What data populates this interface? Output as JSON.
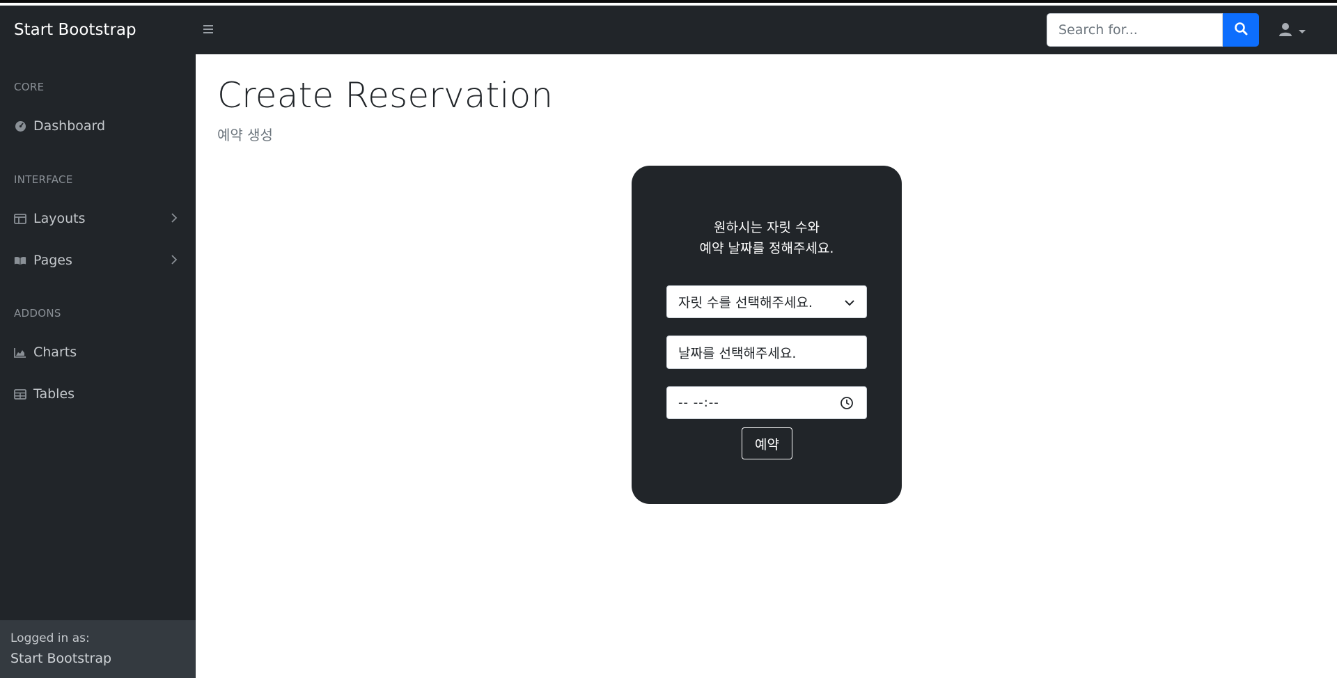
{
  "navbar": {
    "brand": "Start Bootstrap",
    "toggle_icon": "menu-icon",
    "search": {
      "placeholder": "Search for...",
      "value": ""
    },
    "search_button_icon": "search-icon",
    "user_menu_icon": "user-icon",
    "accent_color": "#0d6efd"
  },
  "sidebar": {
    "sections": [
      {
        "heading": "CORE"
      },
      {
        "heading": "INTERFACE"
      },
      {
        "heading": "ADDONS"
      }
    ],
    "items": [
      {
        "label": "Dashboard",
        "icon": "dashboard-icon"
      },
      {
        "label": "Layouts",
        "icon": "columns-icon",
        "has_submenu": true
      },
      {
        "label": "Pages",
        "icon": "book-icon",
        "has_submenu": true
      },
      {
        "label": "Charts",
        "icon": "area-chart-icon"
      },
      {
        "label": "Tables",
        "icon": "table-icon"
      }
    ],
    "footer": {
      "label": "Logged in as:",
      "user": "Start Bootstrap"
    }
  },
  "main": {
    "title": "Create Reservation",
    "subtitle": "예약 생성",
    "form": {
      "message_line1": "원하시는 자릿 수와",
      "message_line2": "예약 날짜를 정해주세요.",
      "seat_select": {
        "selected": "자릿 수를 선택해주세요."
      },
      "date_input": {
        "placeholder": "날짜를 선택해주세요."
      },
      "time_input": {
        "value": "-- --:--"
      },
      "submit_label": "예약"
    }
  }
}
